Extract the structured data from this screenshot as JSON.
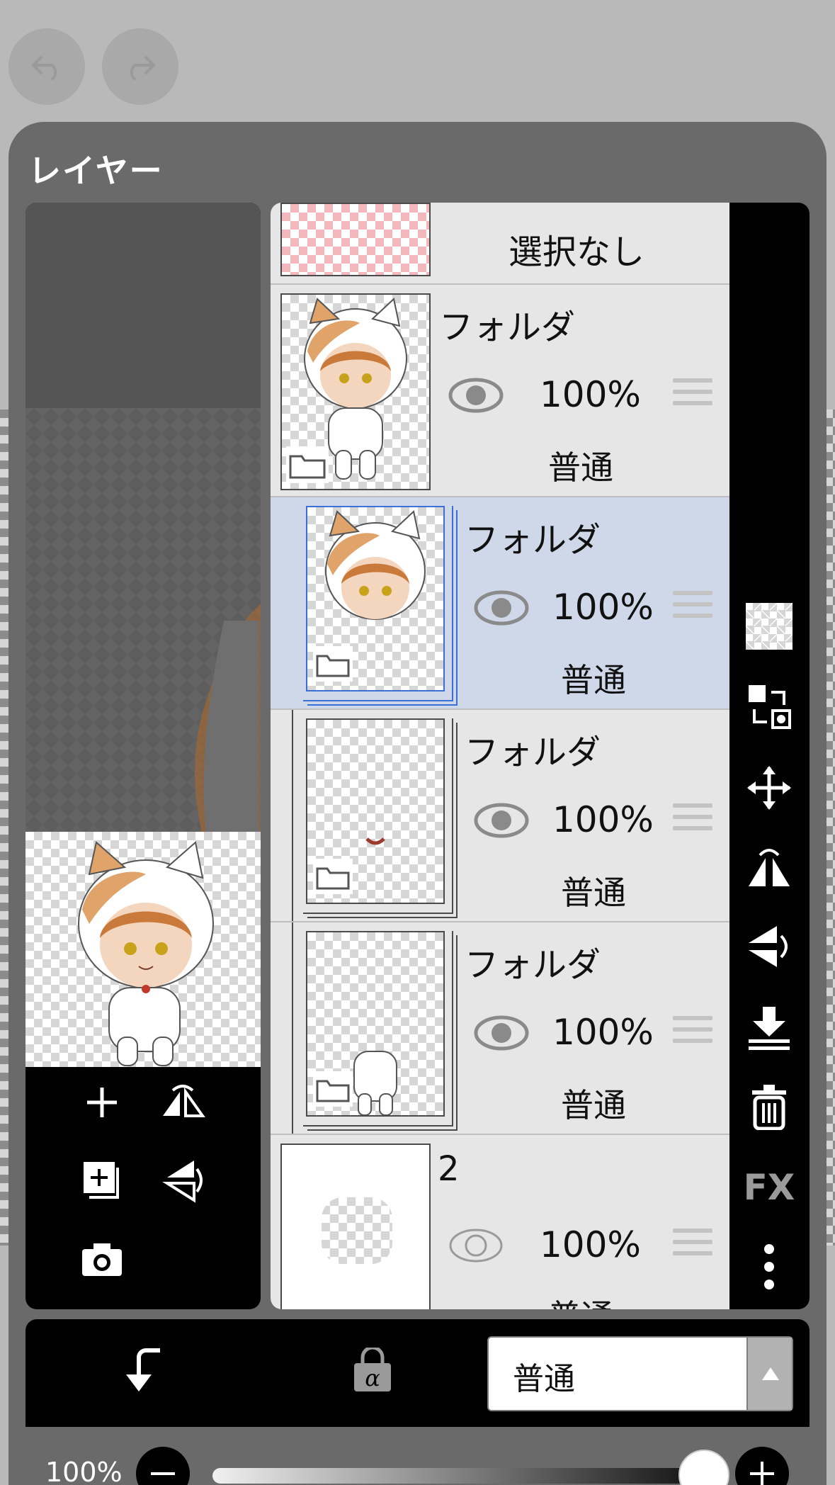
{
  "panel": {
    "title": "レイヤー"
  },
  "layers": [
    {
      "name": "選択なし",
      "type": "selection"
    },
    {
      "name": "フォルダ",
      "opacity": "100%",
      "blend": "普通",
      "visible": true,
      "folder": true,
      "selected": false
    },
    {
      "name": "フォルダ",
      "opacity": "100%",
      "blend": "普通",
      "visible": true,
      "folder": true,
      "selected": true
    },
    {
      "name": "フォルダ",
      "opacity": "100%",
      "blend": "普通",
      "visible": true,
      "folder": true,
      "selected": false
    },
    {
      "name": "フォルダ",
      "opacity": "100%",
      "blend": "普通",
      "visible": true,
      "folder": true,
      "selected": false
    },
    {
      "name": "2",
      "opacity": "100%",
      "blend": "普通",
      "visible": false,
      "folder": false,
      "selected": false
    }
  ],
  "side_toolbar": {
    "fx_label": "FX"
  },
  "bottom": {
    "blend_mode": "普通",
    "opacity_label": "100%",
    "opacity_value": 1.0
  },
  "colors": {
    "panel": "#6a6a6a",
    "selected_row": "#cfd8e9",
    "selected_border": "#3a6fd8"
  }
}
